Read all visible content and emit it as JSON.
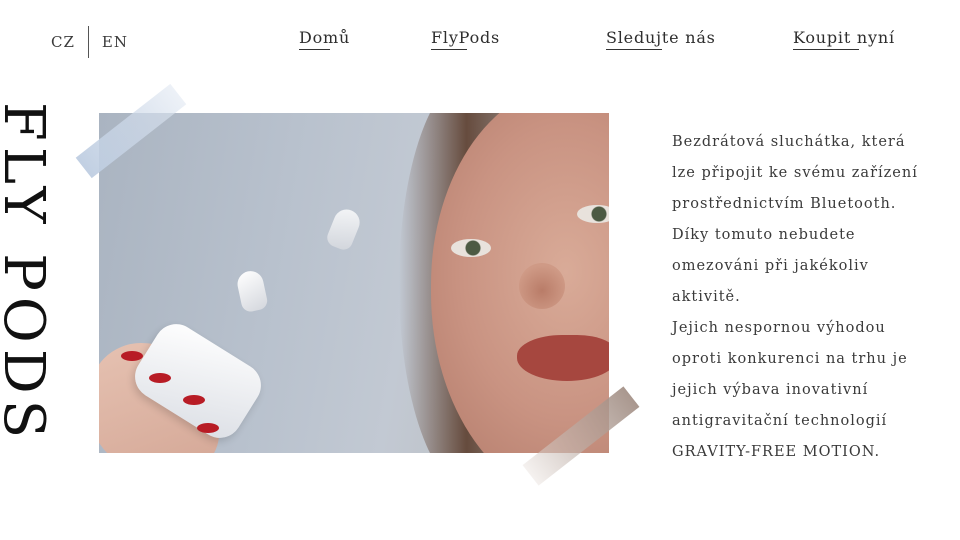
{
  "language": {
    "cz": "CZ",
    "en": "EN"
  },
  "nav": {
    "home": "Domů",
    "flypods": "FlyPods",
    "follow": "Sledujte nás",
    "buy": "Koupit nyní"
  },
  "brand": {
    "title": "FLY PODS"
  },
  "description": {
    "paragraph1": "Bezdrátová sluchátka, která lze připojit ke svému zařízení prostřednictvím Bluetooth. Díky tomuto nebudete omezováni při jakékoliv aktivitě.",
    "paragraph2": "Jejich nespornou výhodou oproti konkurenci na trhu je jejich výbava inovativní antigravitační technologií GRAVITY-FREE MOTION."
  },
  "colors": {
    "text": "#2a2a2a",
    "background": "#ffffff",
    "accent_blue": "#c4d1e3",
    "accent_brown": "#a08c82"
  }
}
